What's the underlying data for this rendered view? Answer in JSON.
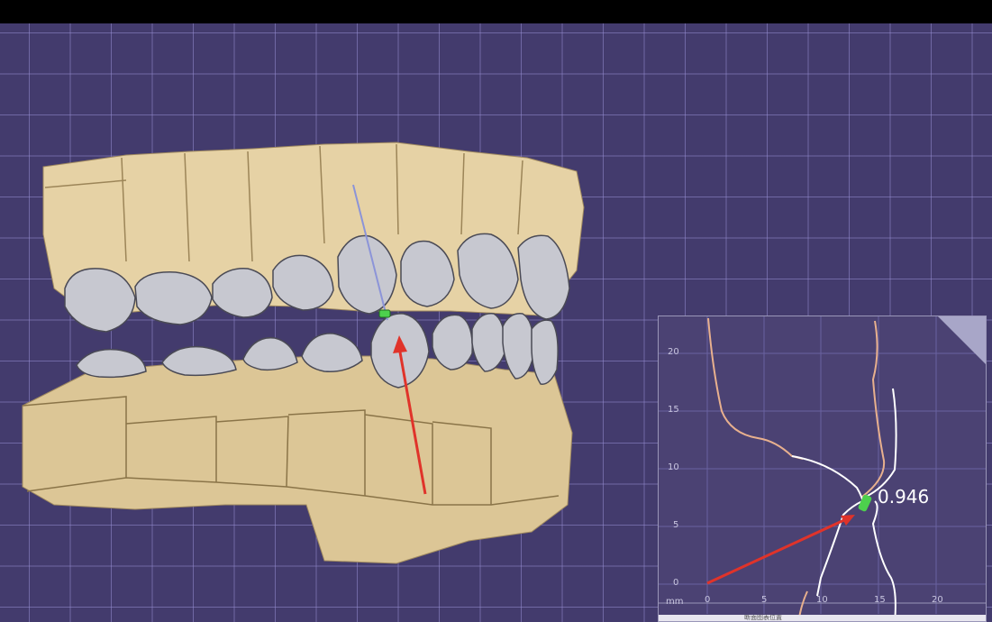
{
  "viewport": {
    "grid_color": "#968cd2",
    "background": "#433b6d"
  },
  "model": {
    "upper_gingiva_color": "#e6d2a5",
    "lower_gingiva_color": "#dcc696",
    "tooth_color": "#c7c8d0",
    "axis_color": "#8c94d8",
    "arrow_color": "#e0332a",
    "contact_color": "#4dd04d"
  },
  "section": {
    "measure_value": "0.946",
    "unit": "mm",
    "y_ticks": [
      "20",
      "15",
      "10",
      "5",
      "0"
    ],
    "x_ticks": [
      "0",
      "5",
      "10",
      "15",
      "20"
    ],
    "footer_text": "断面图表位置",
    "curve_color_upper": "#e8b08e",
    "curve_color_lower": "#ffffff",
    "arrow_color": "#e0332a",
    "contact_color": "#4dd04d"
  }
}
